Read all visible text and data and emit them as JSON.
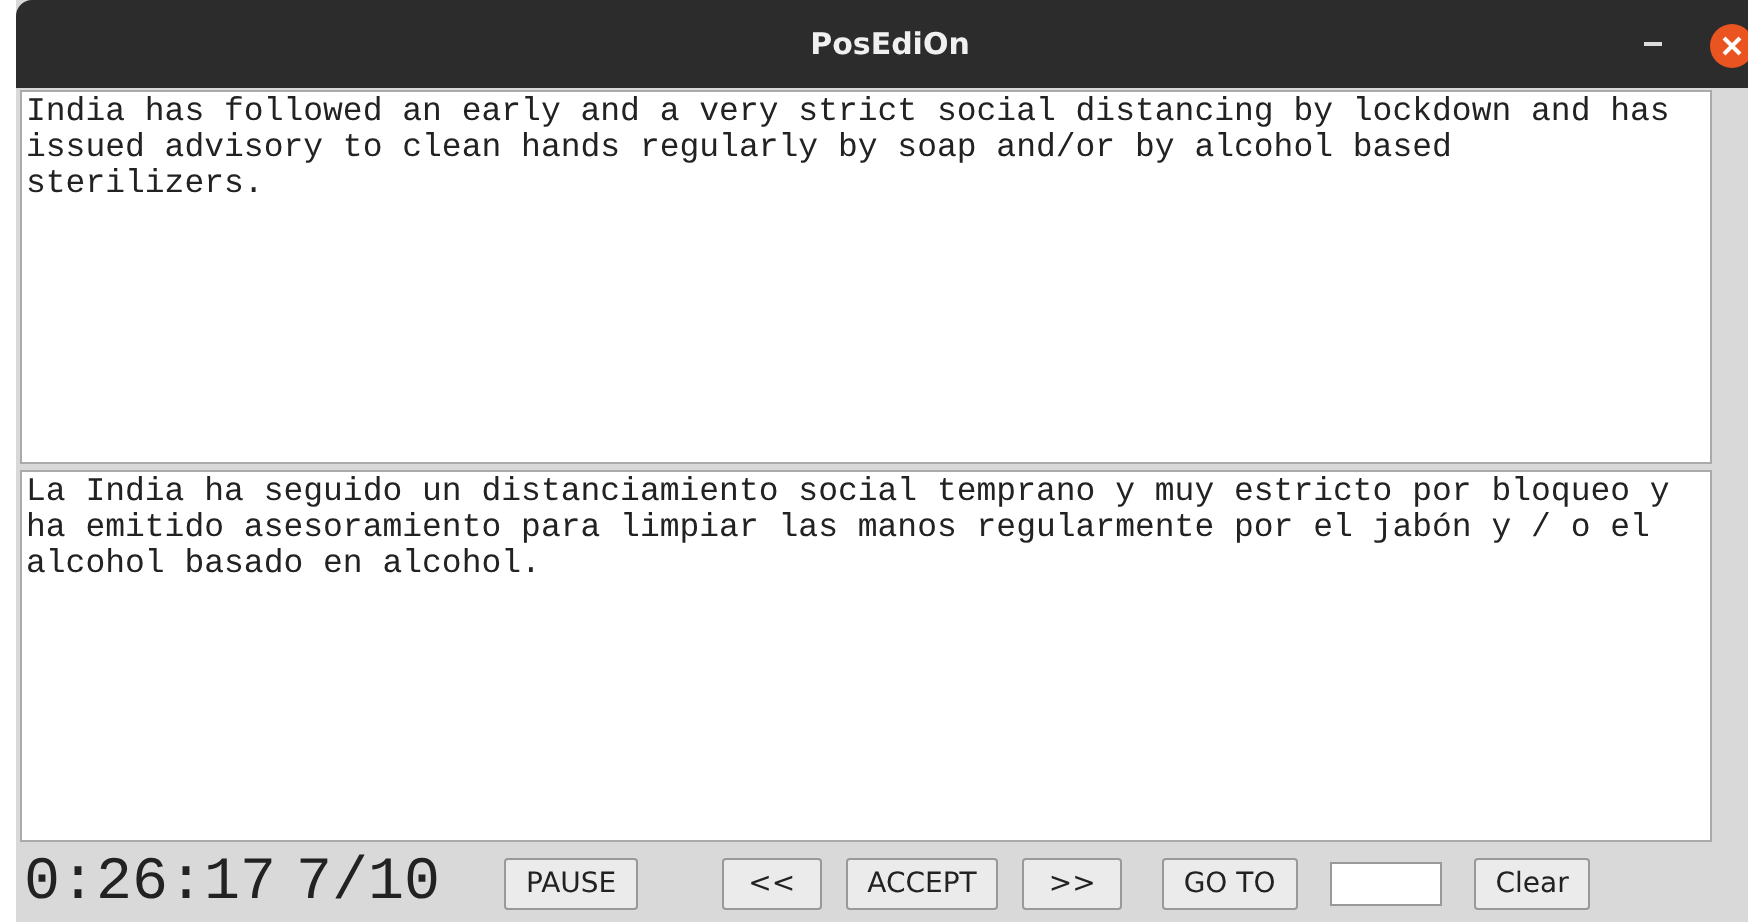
{
  "window": {
    "title": "PosEdiOn"
  },
  "source_text": "India has followed an early and a very strict social distancing by lockdown and has issued advisory to clean hands regularly by soap and/or by alcohol based sterilizers.",
  "target_text": "La India ha seguido un distanciamiento social temprano y muy estricto por bloqueo y ha emitido asesoramiento para limpiar las manos regularmente por el jabón y / o el alcohol basado en alcohol.",
  "toolbar": {
    "timer": "0:26:17",
    "progress": "7/10",
    "buttons": [
      "PAUSE",
      "<<",
      "ACCEPT",
      ">>",
      "GO TO"
    ],
    "clear_button": "Clear"
  }
}
